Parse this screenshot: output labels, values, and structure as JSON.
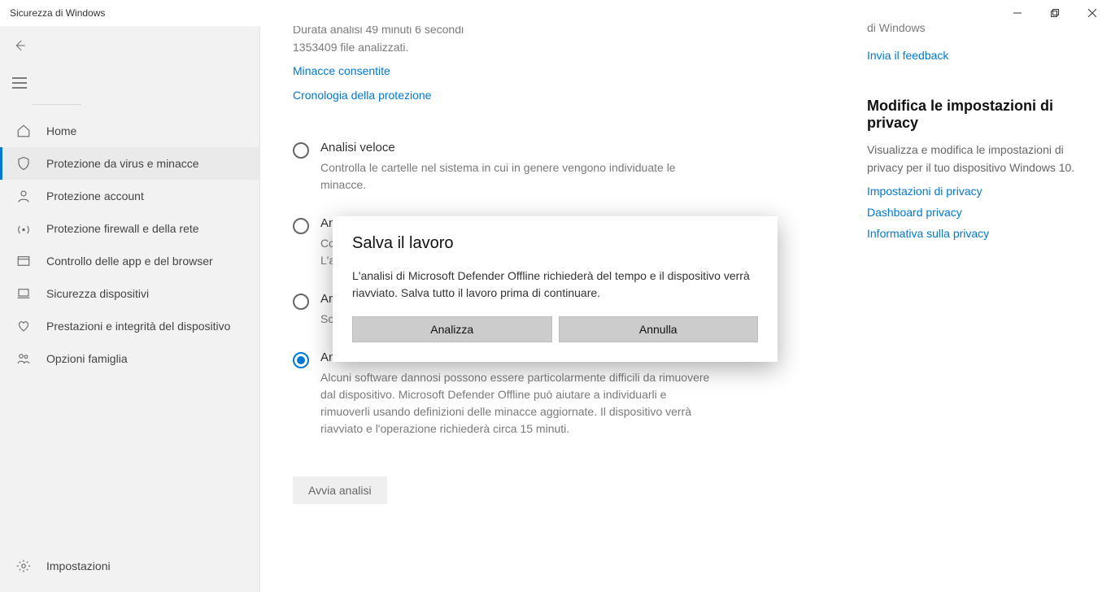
{
  "window": {
    "title": "Sicurezza di Windows"
  },
  "sidebar": {
    "items": [
      {
        "label": "Home"
      },
      {
        "label": "Protezione da virus e minacce"
      },
      {
        "label": "Protezione account"
      },
      {
        "label": "Protezione firewall e della rete"
      },
      {
        "label": "Controllo delle app e del browser"
      },
      {
        "label": "Sicurezza dispositivi"
      },
      {
        "label": "Prestazioni e integrità del dispositivo"
      },
      {
        "label": "Opzioni famiglia"
      }
    ],
    "settings": "Impostazioni"
  },
  "scan_summary": {
    "line1": "Durata analisi 49 minuti 6 secondi",
    "line2": "1353409 file analizzati."
  },
  "links": {
    "allowed_threats": "Minacce consentite",
    "protection_history": "Cronologia della protezione"
  },
  "options": [
    {
      "title": "Analisi veloce",
      "desc": "Controlla le cartelle nel sistema in cui in genere vengono individuate le minacce.",
      "selected": false
    },
    {
      "title": "Ana",
      "desc_line1": "Con",
      "desc_line2": "L'an",
      "selected": false
    },
    {
      "title": "Ana",
      "desc_line1": "Sce",
      "selected": false
    },
    {
      "title": "Analisi di Microsoft Defender Offline",
      "desc": "Alcuni software dannosi possono essere particolarmente difficili da rimuovere dal dispositivo. Microsoft Defender Offline può aiutare a individuarli e rimuoverli usando definizioni delle minacce aggiornate. Il dispositivo verrà riavviato e l'operazione richiederà circa 15 minuti.",
      "selected": true
    }
  ],
  "start_button": "Avvia analisi",
  "right": {
    "fragment": "di Windows",
    "feedback": "Invia il feedback",
    "privacy_title": "Modifica le impostazioni di privacy",
    "privacy_text": "Visualizza e modifica le impostazioni di privacy per il tuo dispositivo Windows 10.",
    "l1": "Impostazioni di privacy",
    "l2": "Dashboard privacy",
    "l3": "Informativa sulla privacy"
  },
  "dialog": {
    "title": "Salva il lavoro",
    "body": "L'analisi di Microsoft Defender Offline richiederà del tempo e il dispositivo verrà riavviato. Salva tutto il lavoro prima di continuare.",
    "ok": "Analizza",
    "cancel": "Annulla"
  }
}
